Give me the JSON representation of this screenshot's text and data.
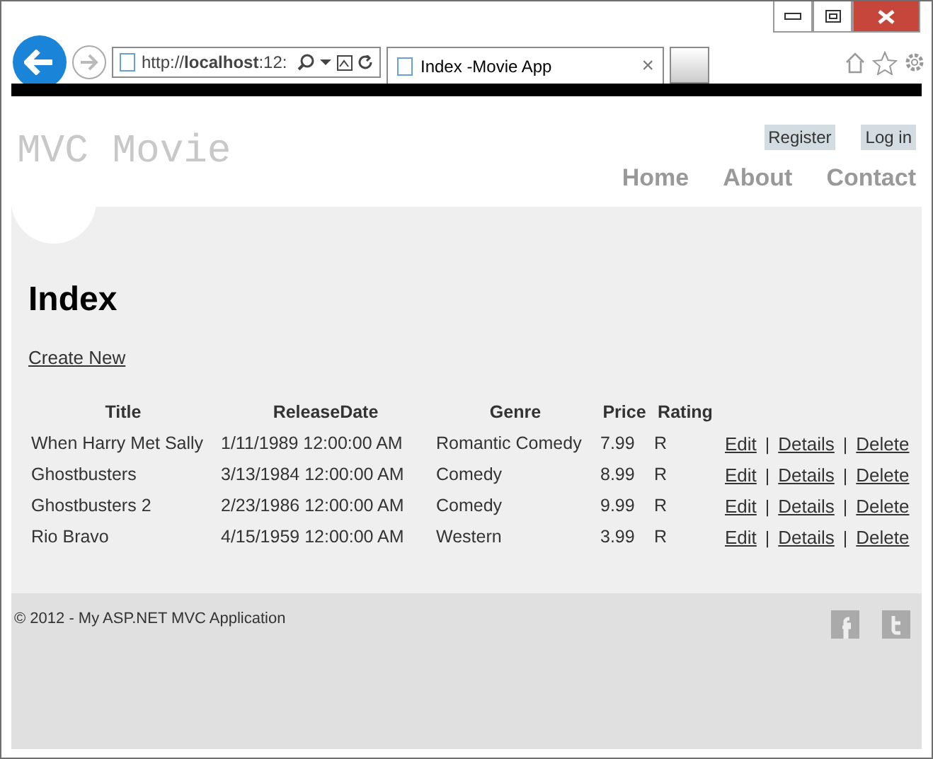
{
  "browser": {
    "address": "http://**localhost**:12:",
    "tab_title": "Index -Movie App",
    "tab_close": "×"
  },
  "site": {
    "logo": "MVC Movie",
    "account_links": [
      "Register",
      "Log in"
    ],
    "nav": [
      "Home",
      "About",
      "Contact"
    ]
  },
  "page": {
    "heading": "Index",
    "create_link": "Create New"
  },
  "table": {
    "columns": [
      "Title",
      "ReleaseDate",
      "Genre",
      "Price",
      "Rating"
    ],
    "rows": [
      {
        "cells": [
          "When Harry Met Sally",
          "1/11/1989 12:00:00 AM",
          "Romantic Comedy",
          "7.99",
          "R"
        ],
        "actions": [
          "Edit",
          "Details",
          "Delete"
        ]
      },
      {
        "cells": [
          "Ghostbusters",
          "3/13/1984 12:00:00 AM",
          "Comedy",
          "8.99",
          "R"
        ],
        "actions": [
          "Edit",
          "Details",
          "Delete"
        ]
      },
      {
        "cells": [
          "Ghostbusters 2",
          "2/23/1986 12:00:00 AM",
          "Comedy",
          "9.99",
          "R"
        ],
        "actions": [
          "Edit",
          "Details",
          "Delete"
        ]
      },
      {
        "cells": [
          "Rio Bravo",
          "4/15/1959 12:00:00 AM",
          "Western",
          "3.99",
          "R"
        ],
        "actions": [
          "Edit",
          "Details",
          "Delete"
        ]
      }
    ],
    "separator": "|"
  },
  "footer": {
    "copyright": "© 2012 - My ASP.NET MVC Application"
  }
}
